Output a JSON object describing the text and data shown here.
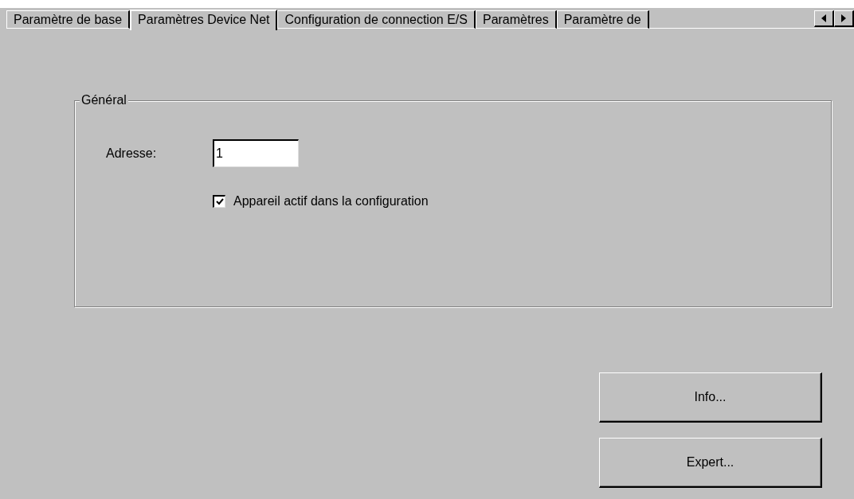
{
  "tabs": [
    {
      "label": "Paramètre de base",
      "selected": false
    },
    {
      "label": "Paramètres Device Net",
      "selected": true
    },
    {
      "label": "Configuration de connection E/S",
      "selected": false
    },
    {
      "label": "Paramètres",
      "selected": false
    },
    {
      "label": "Paramètre de",
      "selected": false
    }
  ],
  "group": {
    "title": "Général",
    "address": {
      "label": "Adresse:",
      "value": "1"
    },
    "active_checkbox": {
      "label": "Appareil actif dans la configuration",
      "checked": true
    }
  },
  "buttons": [
    "Info...",
    "Expert..."
  ]
}
